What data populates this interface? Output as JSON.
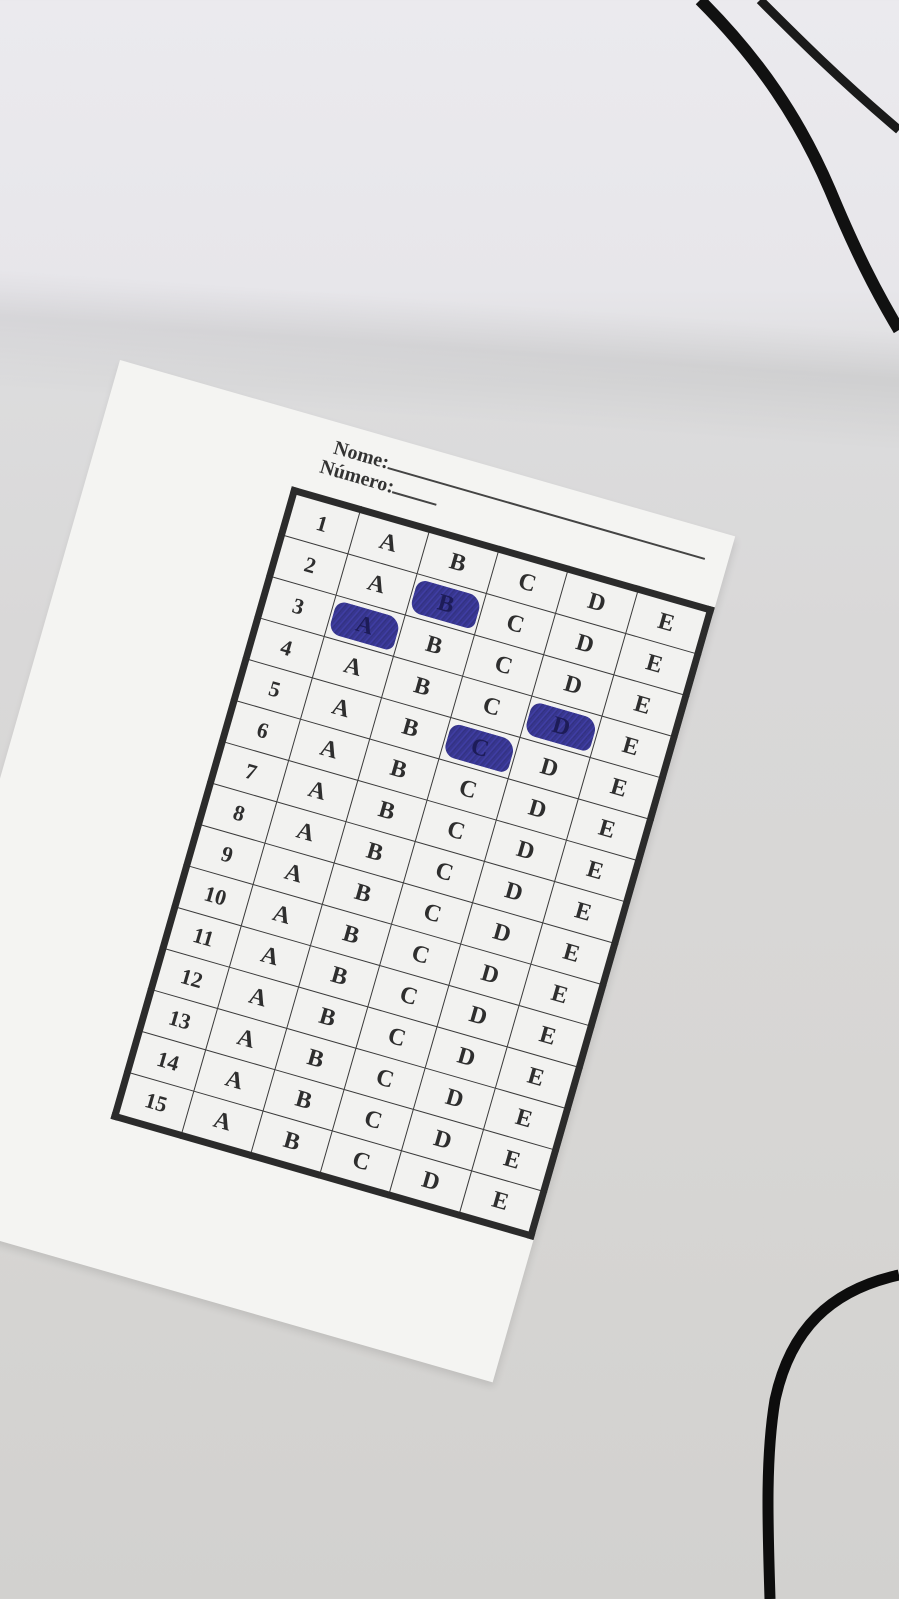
{
  "sheet": {
    "name_label": "Nome:",
    "number_label": "Número:",
    "options": [
      "A",
      "B",
      "C",
      "D",
      "E"
    ],
    "rows": [
      {
        "num": "1",
        "marked": null
      },
      {
        "num": "2",
        "marked": "B"
      },
      {
        "num": "3",
        "marked": "A"
      },
      {
        "num": "4",
        "marked": "D"
      },
      {
        "num": "5",
        "marked": "C"
      },
      {
        "num": "6",
        "marked": null
      },
      {
        "num": "7",
        "marked": null
      },
      {
        "num": "8",
        "marked": null
      },
      {
        "num": "9",
        "marked": null
      },
      {
        "num": "10",
        "marked": null
      },
      {
        "num": "11",
        "marked": null
      },
      {
        "num": "12",
        "marked": null
      },
      {
        "num": "13",
        "marked": null
      },
      {
        "num": "14",
        "marked": null
      },
      {
        "num": "15",
        "marked": null
      }
    ]
  },
  "colors": {
    "ink": "#2b2a86",
    "paper": "#f4f4f2",
    "table_surface": "#d9d8d8",
    "grid_border": "#2b2b2b"
  }
}
